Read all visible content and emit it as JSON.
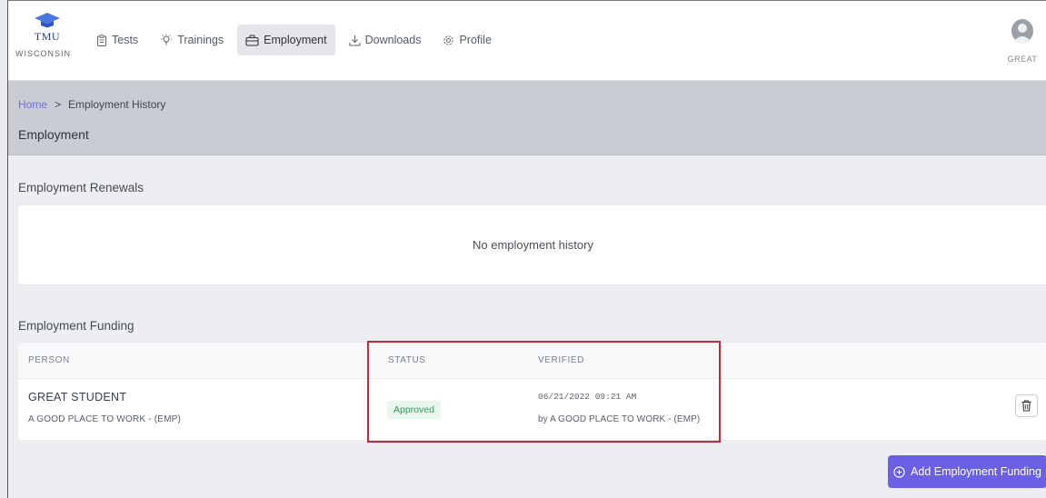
{
  "brand": {
    "name": "TMU",
    "state": "WISCONSIN",
    "cap_color": "#4b76e0"
  },
  "nav": {
    "items": [
      {
        "label": "Tests",
        "icon": "clipboard-icon"
      },
      {
        "label": "Trainings",
        "icon": "lightbulb-icon"
      },
      {
        "label": "Employment",
        "icon": "briefcase-icon",
        "active": true
      },
      {
        "label": "Downloads",
        "icon": "download-icon"
      },
      {
        "label": "Profile",
        "icon": "gear-icon"
      }
    ]
  },
  "user": {
    "label": "GREAT",
    "icon": "avatar-icon"
  },
  "breadcrumb": {
    "home": "Home",
    "separator": ">",
    "current": "Employment History"
  },
  "page": {
    "title": "Employment"
  },
  "renewals": {
    "title": "Employment Renewals",
    "empty_text": "No employment history"
  },
  "funding": {
    "title": "Employment Funding",
    "columns": {
      "person": "PERSON",
      "status": "STATUS",
      "verified": "VERIFIED"
    },
    "rows": [
      {
        "person": "GREAT STUDENT",
        "employer": "A GOOD PLACE TO WORK - (EMP)",
        "status": "Approved",
        "verified_date": "06/21/2022 09:21 AM",
        "verified_by": "by A GOOD PLACE TO WORK - (EMP)"
      }
    ],
    "add_button": "Add Employment Funding"
  },
  "colors": {
    "accent": "#6b5fe6",
    "approved_text": "#2e9a57",
    "approved_bg": "#e8f6ed",
    "highlight": "#c5293a",
    "link": "#6f71d6"
  }
}
